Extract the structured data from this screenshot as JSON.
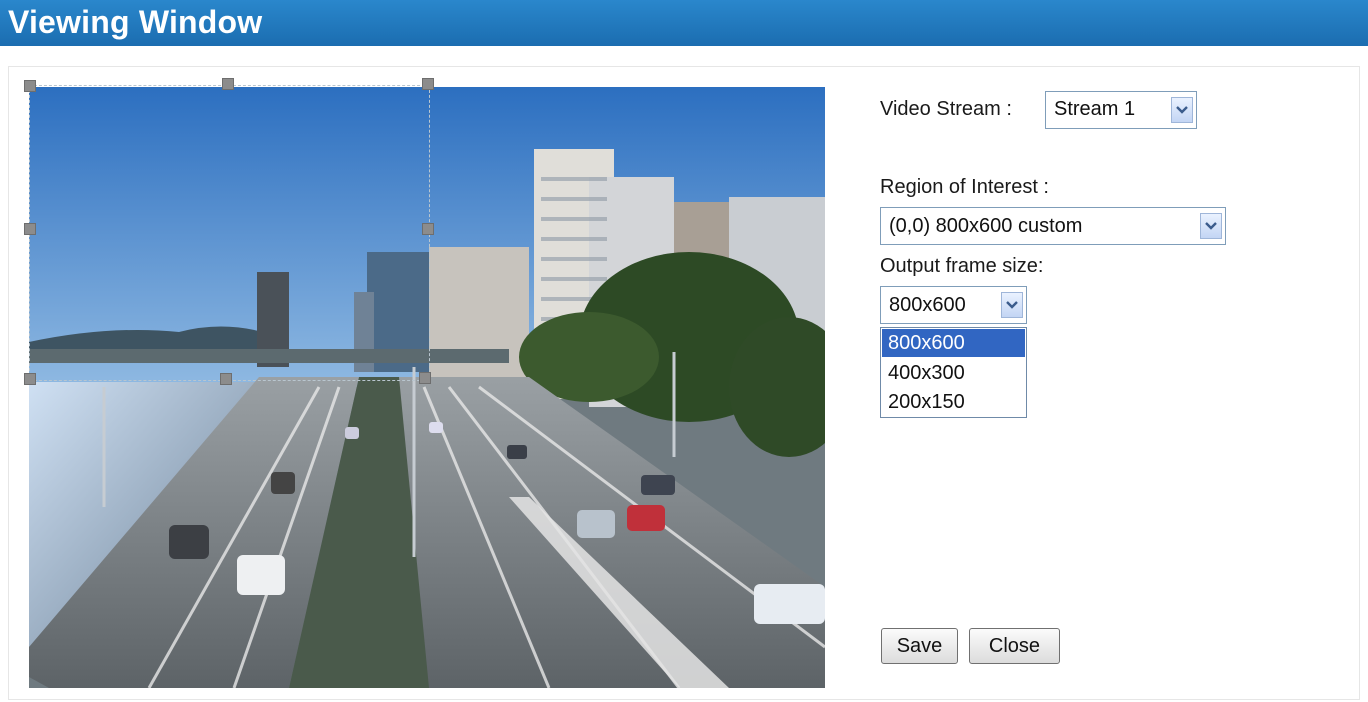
{
  "window": {
    "title": "Viewing Window"
  },
  "video_stream": {
    "label": "Video Stream :",
    "value": "Stream 1"
  },
  "region_of_interest": {
    "label": "Region of Interest :",
    "value": "(0,0) 800x600 custom"
  },
  "output_frame_size": {
    "label": "Output frame size:",
    "value": "800x600",
    "options": [
      "800x600",
      "400x300",
      "200x150"
    ],
    "highlighted_option": "800x600"
  },
  "buttons": {
    "save": "Save",
    "close": "Close"
  },
  "colors": {
    "title_bar": "#1b6db0",
    "option_highlight": "#3166c2"
  }
}
